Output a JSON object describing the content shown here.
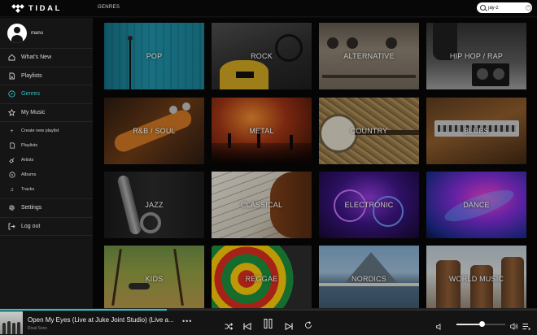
{
  "app": {
    "logo_text": "TIDAL",
    "page_title": "GENRES"
  },
  "search": {
    "value": "jay-z",
    "placeholder": ""
  },
  "user": {
    "name": "manu"
  },
  "nav": [
    {
      "label": "What's New",
      "icon": "home-icon"
    },
    {
      "label": "Playlists",
      "icon": "playlist-icon"
    },
    {
      "label": "Genres",
      "icon": "compass-icon",
      "active": true
    },
    {
      "label": "My Music",
      "icon": "star-icon"
    }
  ],
  "my_music": [
    {
      "label": "Create new playlist",
      "icon": "plus-icon"
    },
    {
      "label": "Playlists",
      "icon": "playlist-icon"
    },
    {
      "label": "Artists",
      "icon": "artist-icon"
    },
    {
      "label": "Albums",
      "icon": "album-icon"
    },
    {
      "label": "Tracks",
      "icon": "note-icon"
    }
  ],
  "footer_nav": [
    {
      "label": "Settings",
      "icon": "gear-icon"
    },
    {
      "label": "Log out",
      "icon": "logout-icon"
    }
  ],
  "genres": [
    {
      "label": "POP"
    },
    {
      "label": "ROCK"
    },
    {
      "label": "ALTERNATIVE"
    },
    {
      "label": "HIP HOP / RAP"
    },
    {
      "label": "R&B / SOUL"
    },
    {
      "label": "METAL"
    },
    {
      "label": "COUNTRY"
    },
    {
      "label": "BLUES"
    },
    {
      "label": "JAZZ"
    },
    {
      "label": "CLASSICAL"
    },
    {
      "label": "ELECTRONIC"
    },
    {
      "label": "DANCE"
    },
    {
      "label": "KIDS"
    },
    {
      "label": "REGGAE"
    },
    {
      "label": "NORDICS"
    },
    {
      "label": "WORLD MUSIC"
    }
  ],
  "player": {
    "track_title": "Open My Eyes (Live at Juke Joint Studio) (Live a...",
    "artist": "Rival Sons",
    "more_label": "•••",
    "progress": 0.31,
    "volume": 0.52
  },
  "colors": {
    "accent": "#2cc3c6",
    "background": "#050505",
    "sidebar": "#151515"
  }
}
